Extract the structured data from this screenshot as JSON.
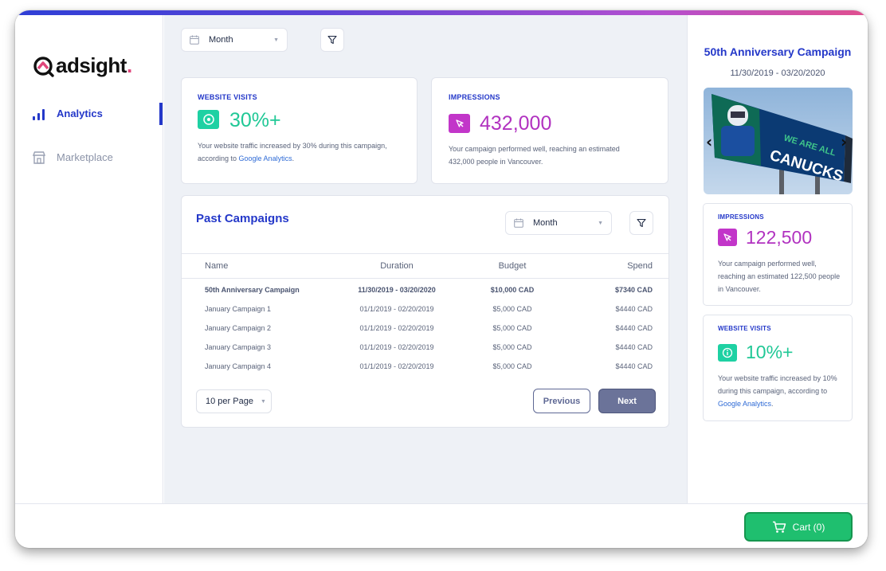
{
  "brand": {
    "name": "adsight",
    "dot": ".",
    "accent": "#2438c9"
  },
  "sidebar": {
    "items": [
      {
        "label": "Analytics",
        "icon": "bar-chart-icon",
        "active": true
      },
      {
        "label": "Marketplace",
        "icon": "storefront-icon",
        "active": false
      }
    ]
  },
  "main": {
    "period_select": "Month",
    "cards": {
      "website_visits": {
        "label": "WEBSITE VISITS",
        "value": "30%+",
        "desc_before": "Your website traffic increased by 30% during this campaign, according to ",
        "desc_link": "Google Analytics",
        "desc_after": "."
      },
      "impressions": {
        "label": "IMPRESSIONS",
        "value": "432,000",
        "desc": "Your campaign performed well, reaching an estimated 432,000 people in Vancouver."
      }
    },
    "past_campaigns": {
      "title": "Past Campaigns",
      "period_select": "Month",
      "columns": [
        "Name",
        "Duration",
        "Budget",
        "Spend"
      ],
      "rows": [
        {
          "name": "50th Anniversary Campaign",
          "duration": "11/30/2019 - 03/20/2020",
          "budget": "$10,000 CAD",
          "spend": "$7340 CAD"
        },
        {
          "name": "January Campaign 1",
          "duration": "01/1/2019 - 02/20/2019",
          "budget": "$5,000 CAD",
          "spend": "$4440 CAD"
        },
        {
          "name": "January Campaign 2",
          "duration": "01/1/2019 - 02/20/2019",
          "budget": "$5,000 CAD",
          "spend": "$4440 CAD"
        },
        {
          "name": "January Campaign 3",
          "duration": "01/1/2019 - 02/20/2019",
          "budget": "$5,000 CAD",
          "spend": "$4440 CAD"
        },
        {
          "name": "January Campaign 4",
          "duration": "01/1/2019 - 02/20/2019",
          "budget": "$5,000 CAD",
          "spend": "$4440 CAD"
        }
      ],
      "per_page": "10 per Page",
      "previous_label": "Previous",
      "next_label": "Next"
    }
  },
  "detail_panel": {
    "title": "50th Anniversary Campaign",
    "dates": "11/30/2019 - 03/20/2020",
    "billboard_text": [
      "WE ARE ALL",
      "CANUCKS"
    ],
    "impressions": {
      "label": "IMPRESSIONS",
      "value": "122,500",
      "desc": "Your campaign performed well, reaching an estimated 122,500 people in Vancouver."
    },
    "website_visits": {
      "label": "WEBSITE VISITS",
      "value": "10%+",
      "desc_before": "Your website traffic increased by 10% during this campaign, according to ",
      "desc_link": "Google Analytics",
      "desc_after": "."
    }
  },
  "footer": {
    "cart_label": "Cart (0)"
  },
  "colors": {
    "green": "#1ed1a3",
    "purple": "#c236c9",
    "cart_green": "#1fbf6f",
    "background": "#eef1f6"
  }
}
